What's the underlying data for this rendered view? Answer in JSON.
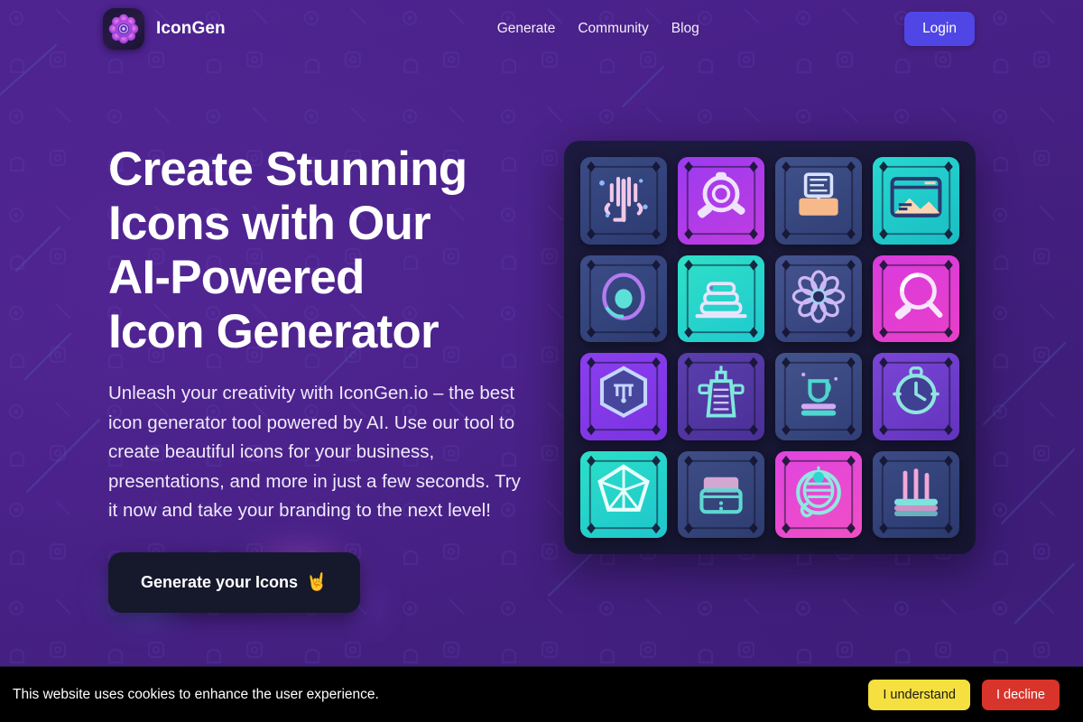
{
  "brand": {
    "name": "IconGen",
    "logo_icon": "flower-gear-logo-icon"
  },
  "nav": {
    "links": [
      {
        "label": "Generate"
      },
      {
        "label": "Community"
      },
      {
        "label": "Blog"
      }
    ],
    "login_label": "Login"
  },
  "hero": {
    "headline_lines": [
      "Create Stunning",
      "Icons with Our",
      "AI-Powered",
      "Icon Generator"
    ],
    "subcopy": "Unleash your creativity with IconGen.io – the best icon generator tool powered by AI. Use our tool to create beautiful icons for your business, presentations, and more in just a few seconds. Try it now and take your branding to the next level!",
    "cta_label": "Generate your Icons",
    "cta_emoji": "🤘"
  },
  "icon_grid": [
    {
      "name": "cactus-icon",
      "bg_from": "#3b4b85",
      "bg_to": "#2b3a70",
      "stroke": "#f0c8e8",
      "accent": "#8fb8ff"
    },
    {
      "name": "magnifier-icon",
      "bg_from": "#9b3bf0",
      "bg_to": "#c13ce0",
      "stroke": "#efe2fb",
      "accent": "#ffffff"
    },
    {
      "name": "laptop-desk-icon",
      "bg_from": "#41518c",
      "bg_to": "#2f3f73",
      "stroke": "#f7b98a",
      "accent": "#d8e2ff"
    },
    {
      "name": "window-image-icon",
      "bg_from": "#27d8d0",
      "bg_to": "#19bdc4",
      "stroke": "#fbd6b4",
      "accent": "#2b3a70"
    },
    {
      "name": "avocado-icon",
      "bg_from": "#3d4d88",
      "bg_to": "#2c3c72",
      "stroke": "#b37cf0",
      "accent": "#5ce0d8"
    },
    {
      "name": "layer-cake-icon",
      "bg_from": "#2fe0c7",
      "bg_to": "#1fc9cf",
      "stroke": "#e8e4ff",
      "accent": "#7b6ddb"
    },
    {
      "name": "flower-icon",
      "bg_from": "#45548f",
      "bg_to": "#323f79",
      "stroke": "#cdb8f5",
      "accent": "#9ad8f0"
    },
    {
      "name": "magnet-search-icon",
      "bg_from": "#d93bdd",
      "bg_to": "#e93fc9",
      "stroke": "#f6e6fd",
      "accent": "#ffffff"
    },
    {
      "name": "hexagon-shield-icon",
      "bg_from": "#8b3ef0",
      "bg_to": "#7a34e0",
      "stroke": "#c6d6ff",
      "accent": "#5b7de8"
    },
    {
      "name": "skyscraper-icon",
      "bg_from": "#5b3fae",
      "bg_to": "#4a2f96",
      "stroke": "#7fe8dd",
      "accent": "#d0c6ff"
    },
    {
      "name": "coffee-cup-icon",
      "bg_from": "#44538c",
      "bg_to": "#303f76",
      "stroke": "#4fd6d0",
      "accent": "#d2a9f2"
    },
    {
      "name": "clock-badge-icon",
      "bg_from": "#7a45d6",
      "bg_to": "#6234bd",
      "stroke": "#8fe4de",
      "accent": "#3f3f94"
    },
    {
      "name": "gem-polyhedron-icon",
      "bg_from": "#2be0c8",
      "bg_to": "#1ec5cc",
      "stroke": "#e9fffd",
      "accent": "#b9f4ee"
    },
    {
      "name": "file-tray-icon",
      "bg_from": "#3f4e86",
      "bg_to": "#2d3c70",
      "stroke": "#5fd8d2",
      "accent": "#f0b8e0"
    },
    {
      "name": "chameleon-icon",
      "bg_from": "#e044e0",
      "bg_to": "#f04fc4",
      "stroke": "#8fe8e0",
      "accent": "#2fd6d0"
    },
    {
      "name": "bar-chart-icon",
      "bg_from": "#3c4b84",
      "bg_to": "#2a396e",
      "stroke": "#f2a8d8",
      "accent": "#7fe2dc"
    }
  ],
  "cookie": {
    "message": "This website uses cookies to enhance the user experience.",
    "accept_label": "I understand",
    "decline_label": "I decline"
  },
  "colors": {
    "page_bg": "#4a2189",
    "panel_bg": "#1a1838",
    "login_btn": "#4f46e5",
    "cta_bg": "#16182b",
    "cookie_bg": "#000000",
    "accept_btn": "#f5e03f",
    "decline_btn": "#d9342b"
  }
}
